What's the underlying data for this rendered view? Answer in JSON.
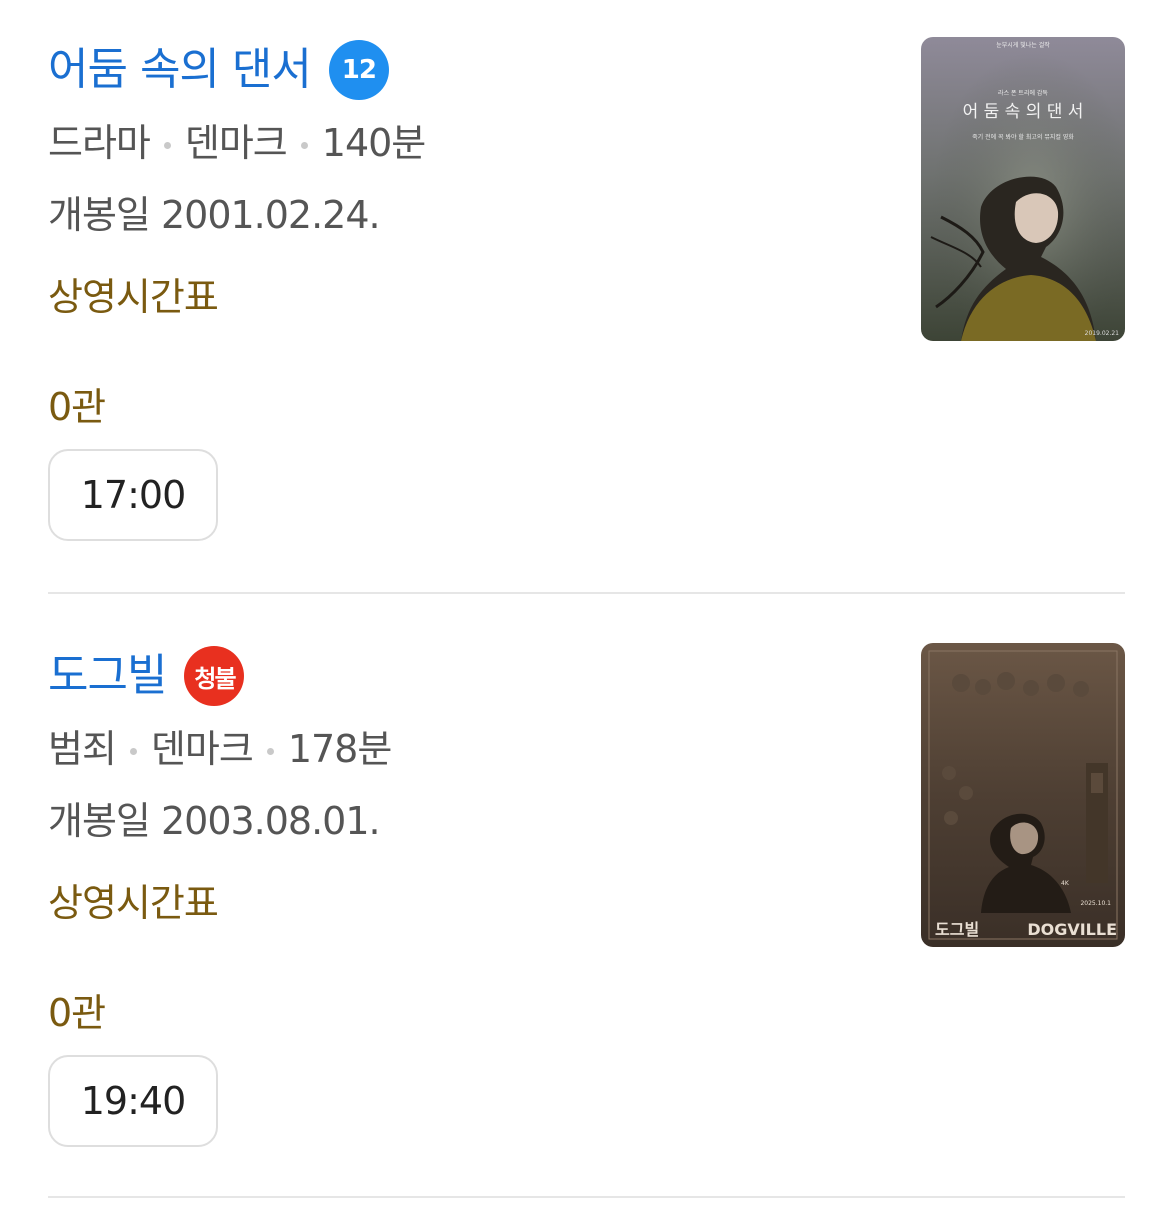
{
  "movies": [
    {
      "title": "어둠 속의 댄서",
      "rating_label": "12",
      "rating_color": "#1f8ff0",
      "genre": "드라마",
      "country": "덴마크",
      "runtime": "140분",
      "release": "개봉일 2001.02.24.",
      "timetable_label": "상영시간표",
      "hall": "0관",
      "showtime": "17:00",
      "poster": {
        "tagline": "눈부시게 빛나는 걸작",
        "director": "라스 폰 트리에 감독",
        "title": "어 둠 속 의 댄 서",
        "subtitle": "죽기 전에 꼭 봐야 할 최고의 뮤지컬 영화",
        "date": "2019.02.21"
      }
    },
    {
      "title": "도그빌",
      "rating_label": "청불",
      "rating_color": "#e8301f",
      "genre": "범죄",
      "country": "덴마크",
      "runtime": "178분",
      "release": "개봉일 2003.08.01.",
      "timetable_label": "상영시간표",
      "hall": "0관",
      "showtime": "19:40",
      "poster": {
        "title_ko": "도그빌",
        "title_en": "DOGVILLE",
        "badge": "4K",
        "date": "2025.10.1"
      }
    }
  ],
  "colors": {
    "title": "#1a6fd1",
    "meta": "#555555",
    "timetable": "#7a5a10",
    "divider": "#e6e6e6"
  }
}
